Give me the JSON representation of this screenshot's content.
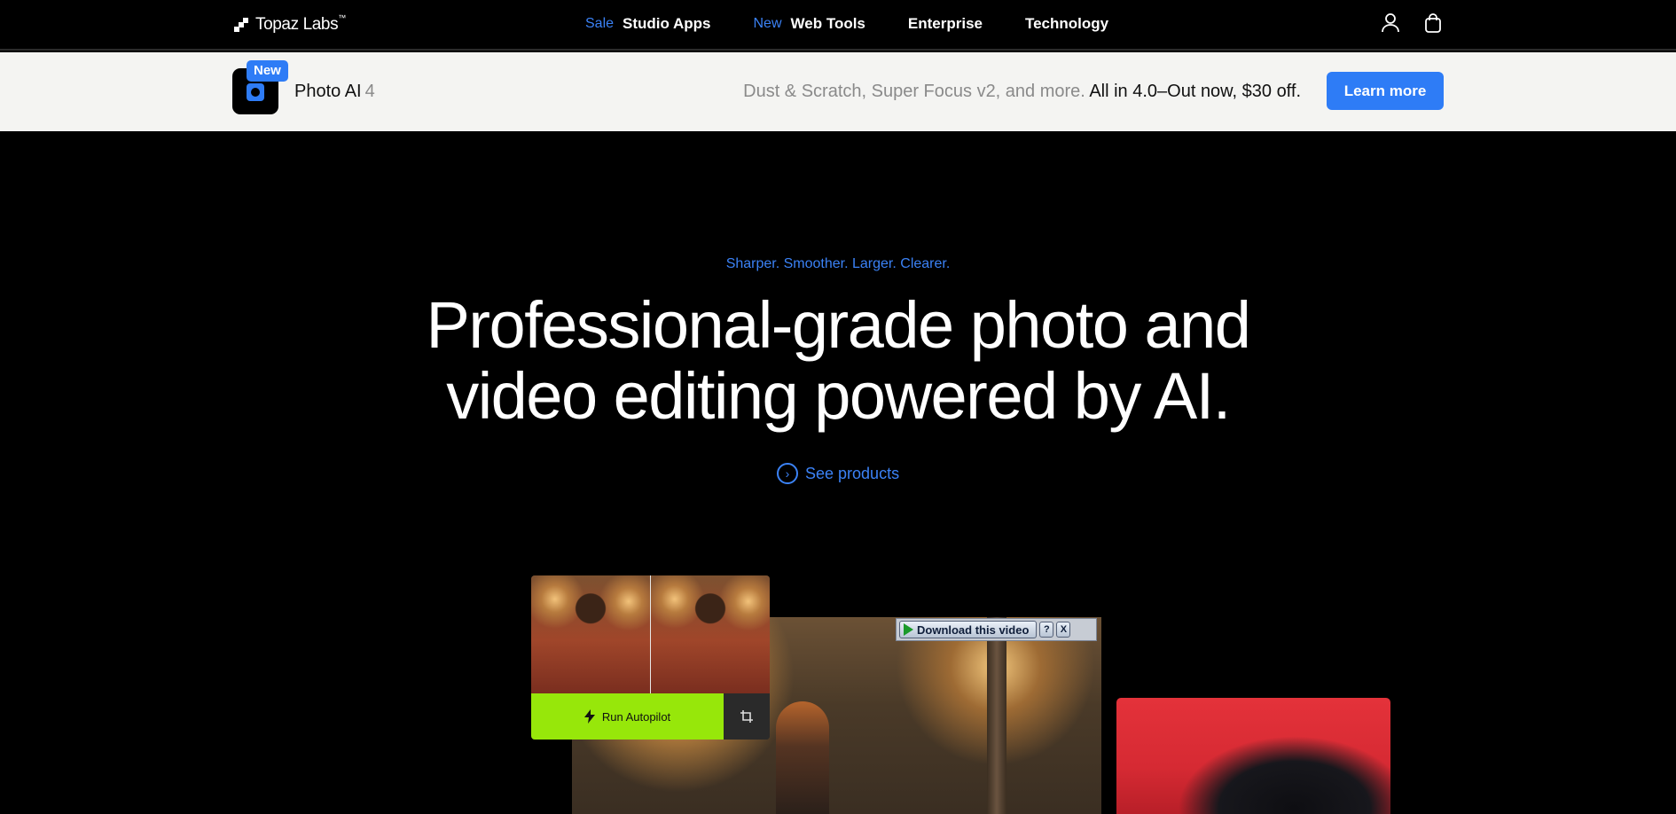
{
  "nav": {
    "logo_text": "Topaz Labs",
    "logo_tm": "™",
    "items": [
      {
        "tag": "Sale",
        "label": "Studio Apps"
      },
      {
        "tag": "New",
        "label": "Web Tools"
      },
      {
        "tag": "",
        "label": "Enterprise"
      },
      {
        "tag": "",
        "label": "Technology"
      }
    ],
    "icons": [
      "user-icon",
      "shopping-bag-icon"
    ]
  },
  "banner": {
    "badge": "New",
    "app_name": "Photo AI",
    "app_version": "4",
    "muted_text": "Dust & Scratch, Super Focus v2, and more.",
    "strong_text": "All in 4.0–Out now, $30 off.",
    "cta": "Learn more"
  },
  "hero": {
    "eyebrow": "Sharper. Smoother. Larger. Clearer.",
    "headline_line1": "Professional-grade photo and",
    "headline_line2": "video editing powered by AI.",
    "link": "See products"
  },
  "media": {
    "download_label": "Download this video",
    "help_label": "?",
    "close_label": "X",
    "run_label": "Run Autopilot"
  },
  "colors": {
    "accent": "#3b82f6",
    "cta_blue": "#2e7cf6",
    "lime": "#97e70a",
    "banner_bg": "#f4f4f2"
  }
}
